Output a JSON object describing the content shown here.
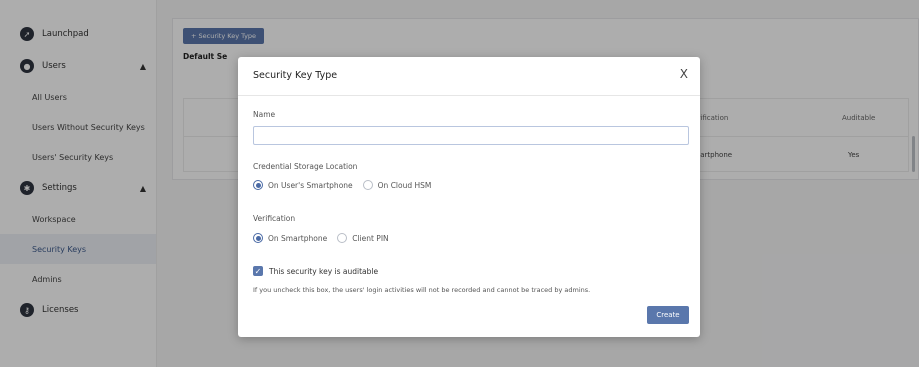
{
  "sidebar": {
    "items": [
      {
        "label": "Launchpad",
        "icon": "rocket-icon"
      },
      {
        "label": "Users",
        "icon": "user-icon"
      },
      {
        "label": "Settings",
        "icon": "gear-icon"
      },
      {
        "label": "Licenses",
        "icon": "key-icon"
      }
    ],
    "users_sub": [
      "All Users",
      "Users Without Security Keys",
      "Users' Security Keys"
    ],
    "settings_sub": [
      "Workspace",
      "Security Keys",
      "Admins"
    ],
    "active_sub": "Security Keys"
  },
  "main": {
    "add_button_label": "+ Security Key Type",
    "default_label": "Default Se",
    "table": {
      "headers": {
        "verification": "Verification",
        "auditable": "Auditable"
      },
      "row": {
        "verification": "Smartphone",
        "auditable": "Yes"
      }
    }
  },
  "modal": {
    "title": "Security Key Type",
    "close": "X",
    "name_label": "Name",
    "name_value": "",
    "storage_label": "Credential Storage Location",
    "storage_options": [
      "On User's Smartphone",
      "On Cloud HSM"
    ],
    "storage_selected": "On User's Smartphone",
    "verification_label": "Verification",
    "verification_options": [
      "On Smartphone",
      "Client PIN"
    ],
    "verification_selected": "On Smartphone",
    "auditable_label": "This security key is auditable",
    "auditable_checked": true,
    "help_text": "If you uncheck this box, the users' login activities will not be recorded and cannot be traced by admins.",
    "create_label": "Create"
  },
  "colors": {
    "accent": "#5a77ac",
    "overlay": "rgba(0,0,0,0.32)"
  }
}
